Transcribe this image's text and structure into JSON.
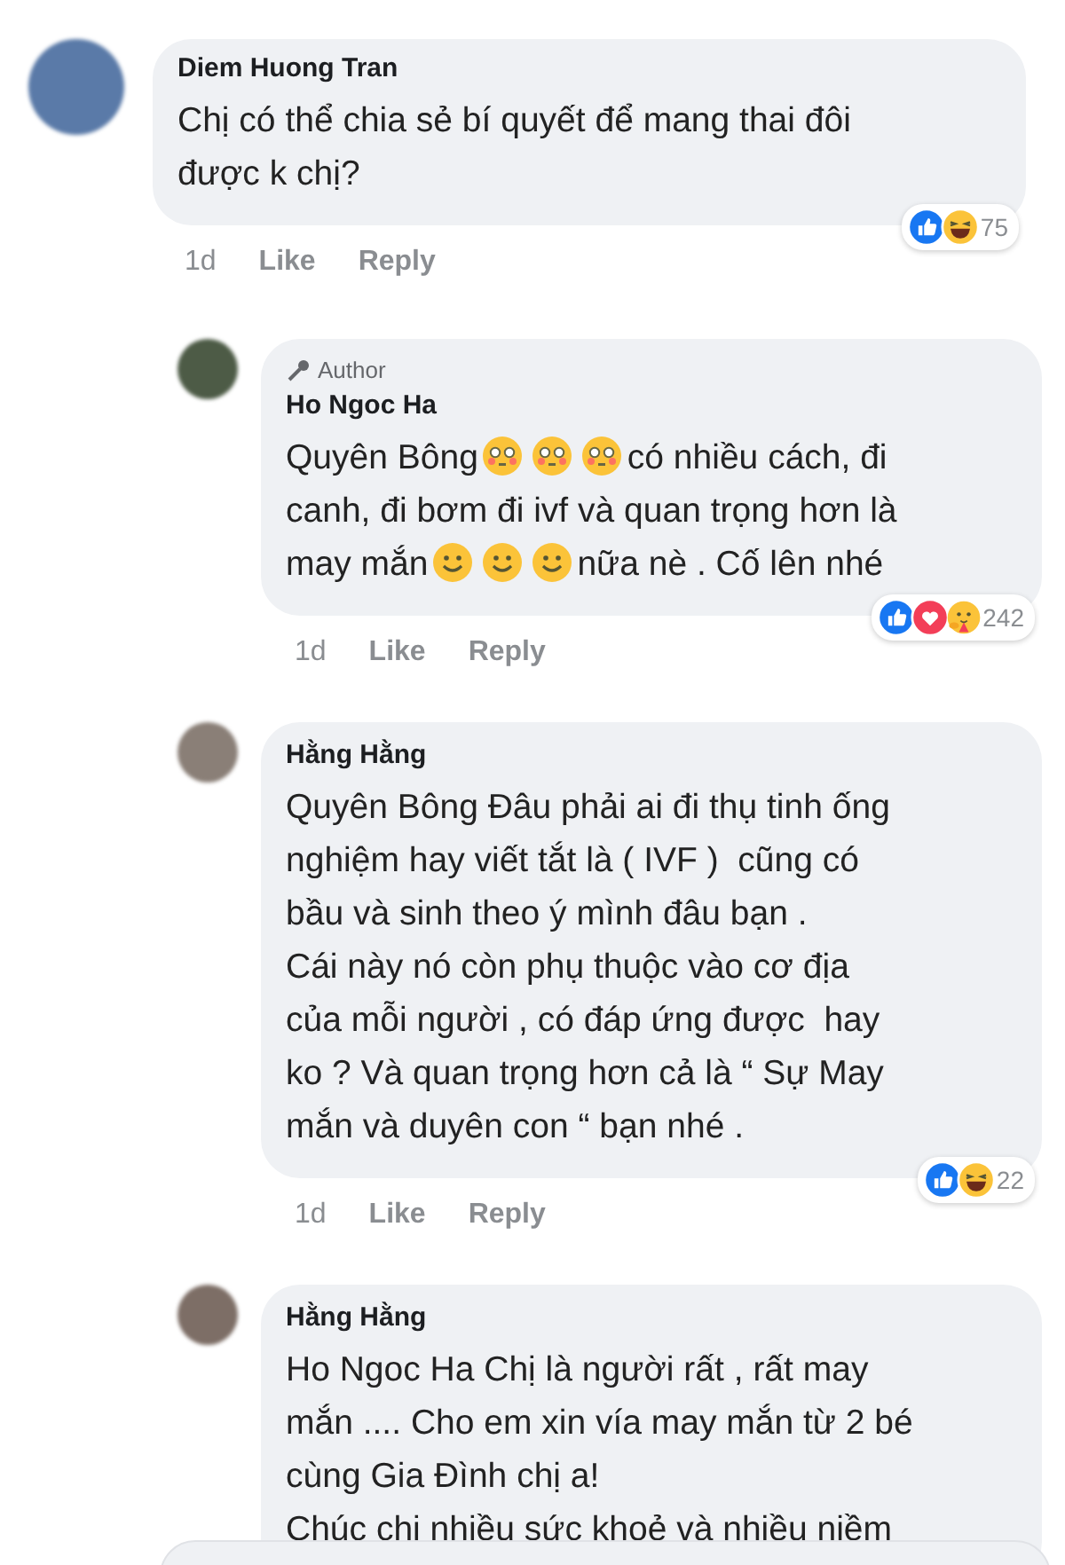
{
  "comments": [
    {
      "reply": false,
      "author": "Diem Huong Tran",
      "body": [
        {
          "kind": "text",
          "text": "Chị có thể chia sẻ bí quyết để mang thai đôi\nđược k chị?"
        }
      ],
      "time": "1d",
      "like": "Like",
      "reply_label": "Reply",
      "reactions": [
        {
          "kind": "like"
        },
        {
          "kind": "haha"
        }
      ],
      "reaction_count": "75"
    },
    {
      "reply": true,
      "badge": "Author",
      "author": "Ho Ngoc Ha",
      "body": [
        {
          "kind": "text",
          "text": "Quyên Bông"
        },
        {
          "kind": "flushed"
        },
        {
          "kind": "flushed"
        },
        {
          "kind": "flushed"
        },
        {
          "kind": "text",
          "text": "có nhiều cách, đi"
        },
        {
          "kind": "break"
        },
        {
          "kind": "text",
          "text": "canh, đi bơm đi ivf và quan trọng hơn là"
        },
        {
          "kind": "break"
        },
        {
          "kind": "text",
          "text": "may mắn"
        },
        {
          "kind": "smile"
        },
        {
          "kind": "smile"
        },
        {
          "kind": "smile"
        },
        {
          "kind": "text",
          "text": "nữa nè . Cố lên nhé"
        }
      ],
      "time": "1d",
      "like": "Like",
      "reply_label": "Reply",
      "reactions": [
        {
          "kind": "like"
        },
        {
          "kind": "love"
        },
        {
          "kind": "care"
        }
      ],
      "reaction_count": "242"
    },
    {
      "reply": true,
      "author": "Hằng Hằng",
      "body": [
        {
          "kind": "text",
          "text": "Quyên Bông Đâu phải ai đi thụ tinh ống\nnghiệm hay viết tắt là ( IVF )  cũng có\nbầu và sinh theo ý mình đâu bạn .\nCái này nó còn phụ thuộc vào cơ địa\ncủa mỗi người , có đáp ứng được  hay\nko ? Và quan trọng hơn cả là “ Sự May\nmắn và duyên con “ bạn nhé ."
        }
      ],
      "time": "1d",
      "like": "Like",
      "reply_label": "Reply",
      "reactions": [
        {
          "kind": "like"
        },
        {
          "kind": "haha"
        }
      ],
      "reaction_count": "22"
    },
    {
      "reply": true,
      "author": "Hằng Hằng",
      "body": [
        {
          "kind": "text",
          "text": "Ho Ngoc Ha Chị là người rất , rất may\nmắn .... Cho em xin vía may mắn từ 2 bé\ncùng Gia Đình chị a!\nChúc chị nhiều sức khoẻ và nhiều niềm"
        }
      ]
    }
  ]
}
